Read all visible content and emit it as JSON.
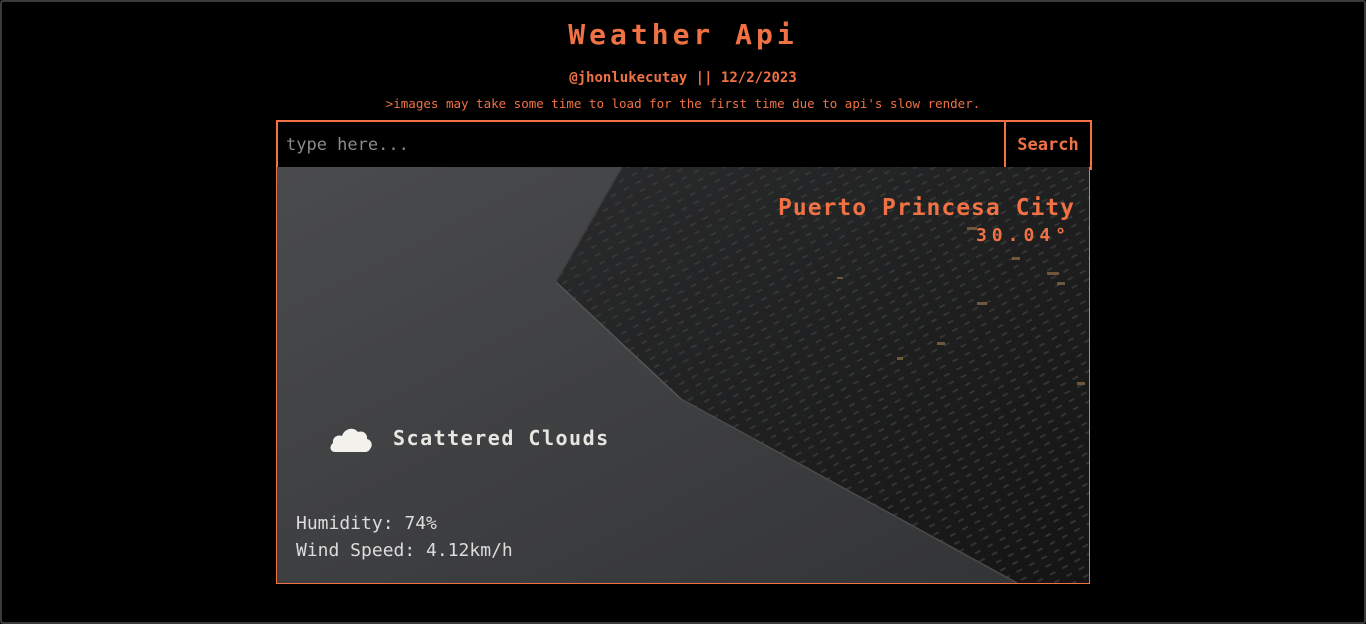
{
  "header": {
    "title": "Weather Api",
    "byline": "@jhonlukecutay || 12/2/2023",
    "note": ">images may take some time to load for the first time due to api's slow render."
  },
  "search": {
    "placeholder": "type here...",
    "value": "",
    "button_label": "Search"
  },
  "weather": {
    "city": "Puerto Princesa City",
    "temperature": "30.04°",
    "condition": "Scattered Clouds",
    "condition_icon": "cloud-icon",
    "humidity": "Humidity: 74%",
    "wind_speed": "Wind Speed: 4.12km/h"
  },
  "colors": {
    "accent": "#f07244",
    "background": "#000000"
  }
}
